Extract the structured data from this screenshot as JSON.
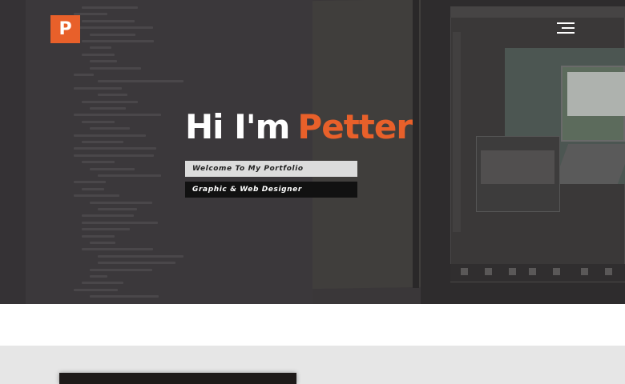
{
  "brand": {
    "logo_letter": "P",
    "accent_color": "#e8602a"
  },
  "nav": {
    "menu_icon": "hamburger-icon"
  },
  "hero": {
    "greeting": "Hi I'm",
    "name": "Petter",
    "tagline_1": "Welcome To My Portfolio",
    "tagline_2": "Graphic & Web Designer"
  }
}
